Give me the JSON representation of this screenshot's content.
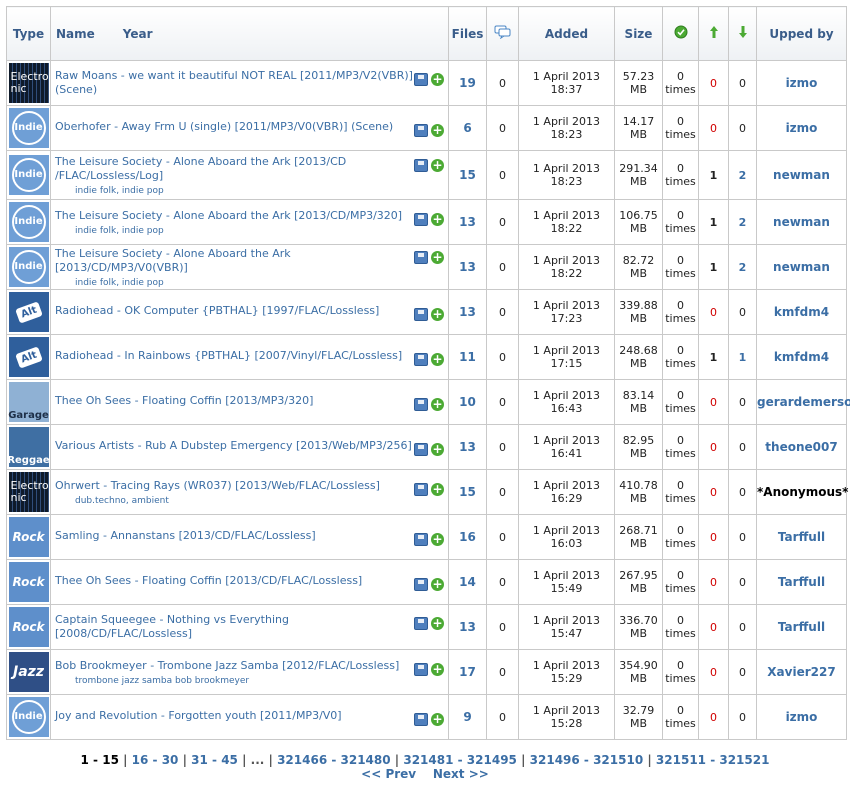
{
  "header": {
    "type": "Type",
    "name": "Name",
    "year": "Year",
    "files": "Files",
    "added": "Added",
    "size": "Size",
    "upped_by": "Upped by"
  },
  "torrents": [
    {
      "type": "Electronic",
      "type_line1": "Electro",
      "type_line2": "nic",
      "name": "Raw Moans - we want it beautiful NOT REAL [2011/MP3/V2(VBR)] (Scene)",
      "tags": "",
      "files": "19",
      "comments": "0",
      "added": "1 April 2013 18:37",
      "size_value": "57.23",
      "size_unit": "MB",
      "snatched_value": "0",
      "snatched_unit": "times",
      "seeders": "0",
      "leechers": "0",
      "user": "izmo"
    },
    {
      "type": "Indie",
      "name": "Oberhofer - Away Frm U (single) [2011/MP3/V0(VBR)] (Scene)",
      "tags": "",
      "files": "6",
      "comments": "0",
      "added": "1 April 2013 18:23",
      "size_value": "14.17",
      "size_unit": "MB",
      "snatched_value": "0",
      "snatched_unit": "times",
      "seeders": "0",
      "leechers": "0",
      "user": "izmo"
    },
    {
      "type": "Indie",
      "name": "The Leisure Society - Alone Aboard the Ark [2013/CD /FLAC/Lossless/Log]",
      "tags": "indie folk, indie pop",
      "files": "15",
      "comments": "0",
      "added": "1 April 2013 18:23",
      "size_value": "291.34",
      "size_unit": "MB",
      "snatched_value": "0",
      "snatched_unit": "times",
      "seeders": "1",
      "leechers": "2",
      "user": "newman"
    },
    {
      "type": "Indie",
      "name": "The Leisure Society - Alone Aboard the Ark [2013/CD/MP3/320]",
      "tags": "indie folk, indie pop",
      "files": "13",
      "comments": "0",
      "added": "1 April 2013 18:22",
      "size_value": "106.75",
      "size_unit": "MB",
      "snatched_value": "0",
      "snatched_unit": "times",
      "seeders": "1",
      "leechers": "2",
      "user": "newman"
    },
    {
      "type": "Indie",
      "name": "The Leisure Society - Alone Aboard the Ark [2013/CD/MP3/V0(VBR)]",
      "tags": "indie folk, indie pop",
      "files": "13",
      "comments": "0",
      "added": "1 April 2013 18:22",
      "size_value": "82.72",
      "size_unit": "MB",
      "snatched_value": "0",
      "snatched_unit": "times",
      "seeders": "1",
      "leechers": "2",
      "user": "newman"
    },
    {
      "type": "Alt",
      "name": "Radiohead - OK Computer {PBTHAL} [1997/FLAC/Lossless]",
      "tags": "",
      "files": "13",
      "comments": "0",
      "added": "1 April 2013 17:23",
      "size_value": "339.88",
      "size_unit": "MB",
      "snatched_value": "0",
      "snatched_unit": "times",
      "seeders": "0",
      "leechers": "0",
      "user": "kmfdm4"
    },
    {
      "type": "Alt",
      "name": "Radiohead - In Rainbows {PBTHAL} [2007/Vinyl/FLAC/Lossless]",
      "tags": "",
      "files": "11",
      "comments": "0",
      "added": "1 April 2013 17:15",
      "size_value": "248.68",
      "size_unit": "MB",
      "snatched_value": "0",
      "snatched_unit": "times",
      "seeders": "1",
      "leechers": "1",
      "user": "kmfdm4"
    },
    {
      "type": "Garage",
      "name": "Thee Oh Sees - Floating Coffin [2013/MP3/320]",
      "tags": "",
      "files": "10",
      "comments": "0",
      "added": "1 April 2013 16:43",
      "size_value": "83.14",
      "size_unit": "MB",
      "snatched_value": "0",
      "snatched_unit": "times",
      "seeders": "0",
      "leechers": "0",
      "user": "gerardemerson"
    },
    {
      "type": "Reggae",
      "name": "Various Artists - Rub A Dubstep Emergency [2013/Web/MP3/256]",
      "tags": "",
      "files": "13",
      "comments": "0",
      "added": "1 April 2013 16:41",
      "size_value": "82.95",
      "size_unit": "MB",
      "snatched_value": "0",
      "snatched_unit": "times",
      "seeders": "0",
      "leechers": "0",
      "user": "theone007"
    },
    {
      "type": "Electronic",
      "type_line1": "Electro",
      "type_line2": "nic",
      "name": "Ohrwert - Tracing Rays (WR037) [2013/Web/FLAC/Lossless]",
      "tags": "dub.techno, ambient",
      "files": "15",
      "comments": "0",
      "added": "1 April 2013 16:29",
      "size_value": "410.78",
      "size_unit": "MB",
      "snatched_value": "0",
      "snatched_unit": "times",
      "seeders": "0",
      "leechers": "0",
      "user": "*Anonymous*"
    },
    {
      "type": "Rock",
      "name": "Samling - Annanstans [2013/CD/FLAC/Lossless]",
      "tags": "",
      "files": "16",
      "comments": "0",
      "added": "1 April 2013 16:03",
      "size_value": "268.71",
      "size_unit": "MB",
      "snatched_value": "0",
      "snatched_unit": "times",
      "seeders": "0",
      "leechers": "0",
      "user": "Tarffull"
    },
    {
      "type": "Rock",
      "name": "Thee Oh Sees - Floating Coffin [2013/CD/FLAC/Lossless]",
      "tags": "",
      "files": "14",
      "comments": "0",
      "added": "1 April 2013 15:49",
      "size_value": "267.95",
      "size_unit": "MB",
      "snatched_value": "0",
      "snatched_unit": "times",
      "seeders": "0",
      "leechers": "0",
      "user": "Tarffull"
    },
    {
      "type": "Rock",
      "name": "Captain Squeegee - Nothing vs Everything [2008/CD/FLAC/Lossless]",
      "tags": "",
      "files": "13",
      "comments": "0",
      "added": "1 April 2013 15:47",
      "size_value": "336.70",
      "size_unit": "MB",
      "snatched_value": "0",
      "snatched_unit": "times",
      "seeders": "0",
      "leechers": "0",
      "user": "Tarffull"
    },
    {
      "type": "Jazz",
      "name": "Bob Brookmeyer - Trombone Jazz Samba [2012/FLAC/Lossless]",
      "tags": "trombone jazz samba bob brookmeyer",
      "files": "17",
      "comments": "0",
      "added": "1 April 2013 15:29",
      "size_value": "354.90",
      "size_unit": "MB",
      "snatched_value": "0",
      "snatched_unit": "times",
      "seeders": "0",
      "leechers": "0",
      "user": "Xavier227"
    },
    {
      "type": "Indie",
      "name": "Joy and Revolution - Forgotten youth [2011/MP3/V0]",
      "tags": "",
      "files": "9",
      "comments": "0",
      "added": "1 April 2013 15:28",
      "size_value": "32.79",
      "size_unit": "MB",
      "snatched_value": "0",
      "snatched_unit": "times",
      "seeders": "0",
      "leechers": "0",
      "user": "izmo"
    }
  ],
  "pagination": {
    "current": "1 - 15",
    "pages": [
      "16 - 30",
      "31 - 45",
      "...",
      "321466 - 321480",
      "321481 - 321495",
      "321496 - 321510",
      "321511 - 321521"
    ],
    "prev": "<< Prev",
    "next": "Next >>"
  },
  "colors": {
    "link": "#3b6ea5",
    "zero_seeders": "#d00000",
    "upload_arrow": "#4caa34"
  }
}
